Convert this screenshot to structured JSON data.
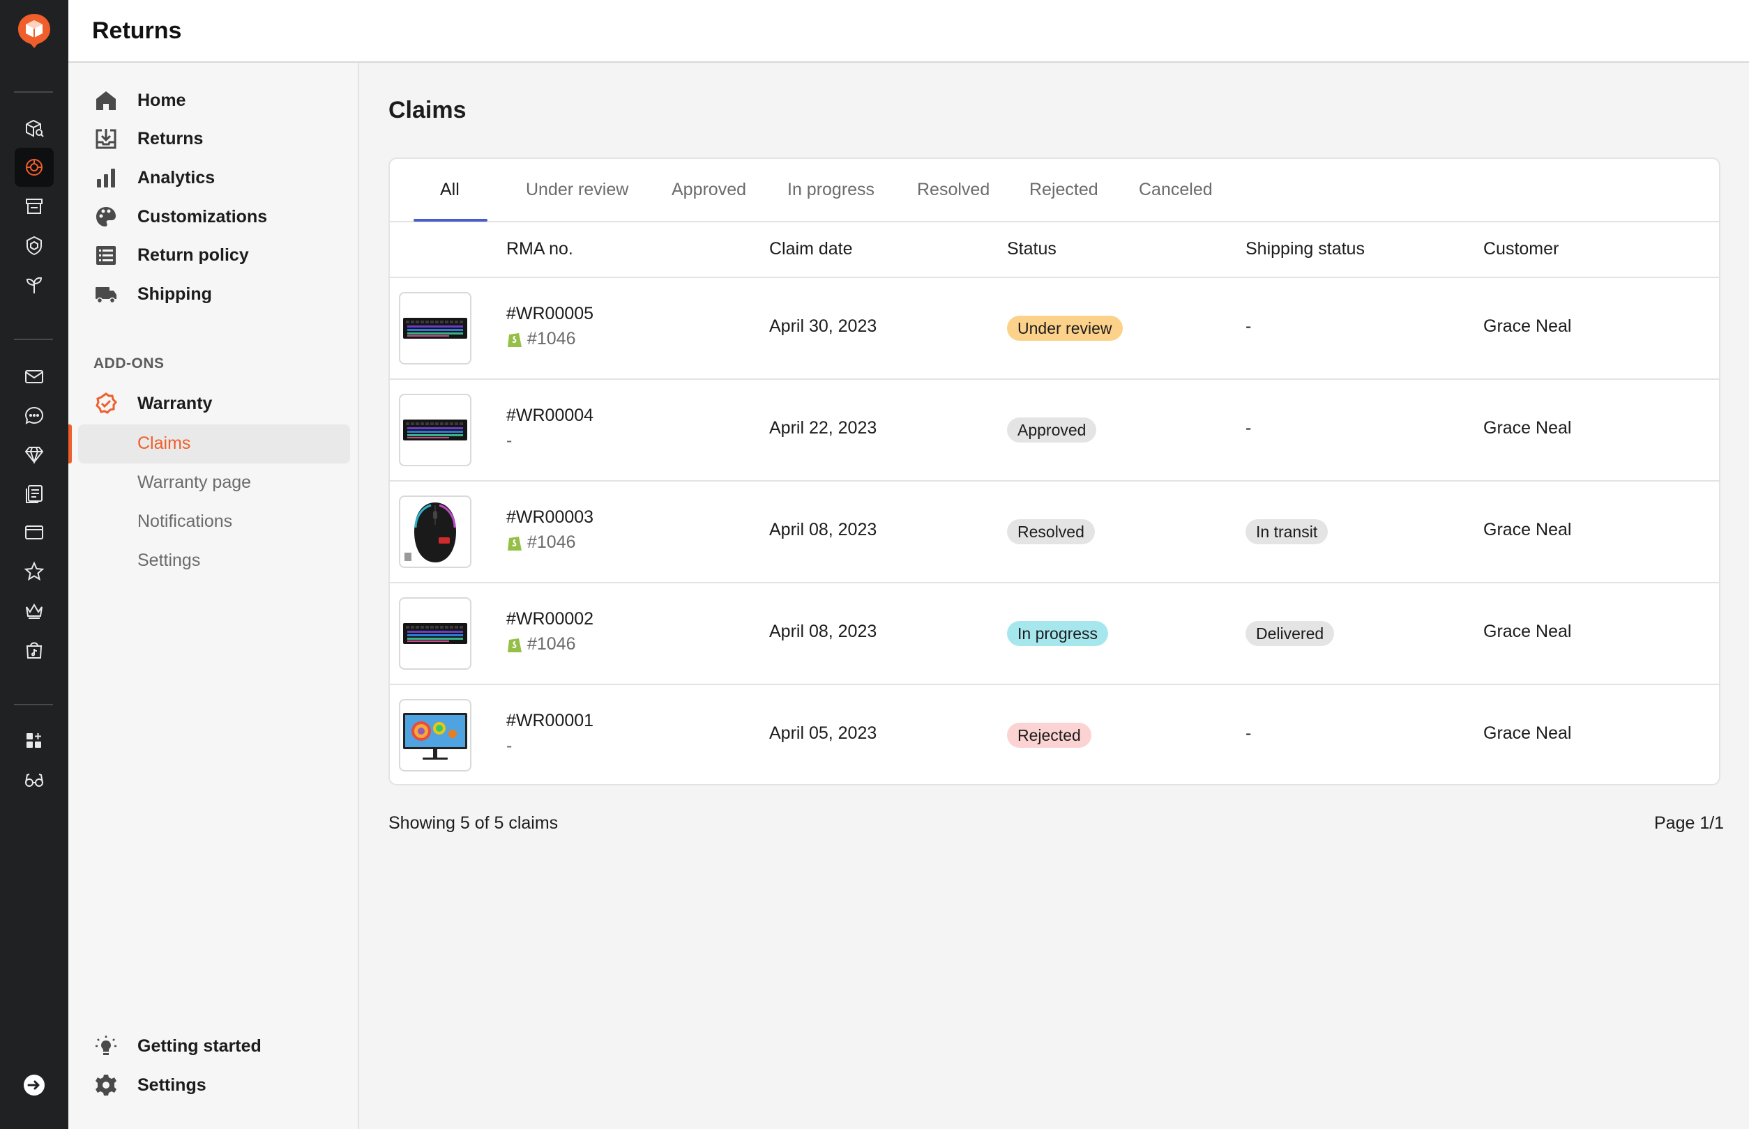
{
  "app": {
    "title": "Returns",
    "accent": "#ef5e2b"
  },
  "rail": {
    "icons": [
      "box-search-icon",
      "returns-lifebuoy-icon",
      "storefront-icon",
      "shield-icon",
      "plant-icon",
      "mail-icon",
      "chat-icon",
      "diamond-icon",
      "document-list-icon",
      "card-icon",
      "star-icon",
      "crown-icon",
      "tiktok-bag-icon",
      "add-widget-icon",
      "glasses-icon"
    ],
    "active": "returns-lifebuoy-icon"
  },
  "sidebar": {
    "items": [
      {
        "label": "Home",
        "icon": "home-icon"
      },
      {
        "label": "Returns",
        "icon": "returns-tray-icon"
      },
      {
        "label": "Analytics",
        "icon": "bar-chart-icon"
      },
      {
        "label": "Customizations",
        "icon": "palette-icon"
      },
      {
        "label": "Return policy",
        "icon": "list-icon"
      },
      {
        "label": "Shipping",
        "icon": "truck-icon"
      }
    ],
    "addons_label": "ADD-ONS",
    "warranty": {
      "label": "Warranty",
      "icon": "warranty-badge-icon"
    },
    "warranty_sub": [
      {
        "label": "Claims",
        "active": true
      },
      {
        "label": "Warranty page",
        "active": false
      },
      {
        "label": "Notifications",
        "active": false
      },
      {
        "label": "Settings",
        "active": false
      }
    ],
    "bottom": [
      {
        "label": "Getting started",
        "icon": "lightbulb-icon"
      },
      {
        "label": "Settings",
        "icon": "gear-icon"
      }
    ]
  },
  "main": {
    "title": "Claims",
    "tabs": [
      "All",
      "Under review",
      "Approved",
      "In progress",
      "Resolved",
      "Rejected",
      "Canceled"
    ],
    "active_tab": "All",
    "columns": [
      "RMA no.",
      "Claim date",
      "Status",
      "Shipping status",
      "Customer"
    ],
    "rows": [
      {
        "product": "keyboard",
        "rma": "#WR00005",
        "order": "#1046",
        "date": "April 30, 2023",
        "status": "Under review",
        "shipping": "-",
        "customer": "Grace Neal"
      },
      {
        "product": "keyboard",
        "rma": "#WR00004",
        "order": "-",
        "date": "April 22, 2023",
        "status": "Approved",
        "shipping": "-",
        "customer": "Grace Neal"
      },
      {
        "product": "mouse",
        "rma": "#WR00003",
        "order": "#1046",
        "date": "April 08, 2023",
        "status": "Resolved",
        "shipping": "In transit",
        "customer": "Grace Neal"
      },
      {
        "product": "keyboard",
        "rma": "#WR00002",
        "order": "#1046",
        "date": "April 08, 2023",
        "status": "In progress",
        "shipping": "Delivered",
        "customer": "Grace Neal"
      },
      {
        "product": "monitor",
        "rma": "#WR00001",
        "order": "-",
        "date": "April 05, 2023",
        "status": "Rejected",
        "shipping": "-",
        "customer": "Grace Neal"
      }
    ],
    "footer": {
      "showing": "Showing 5 of 5 claims",
      "page": "Page 1/1"
    }
  }
}
